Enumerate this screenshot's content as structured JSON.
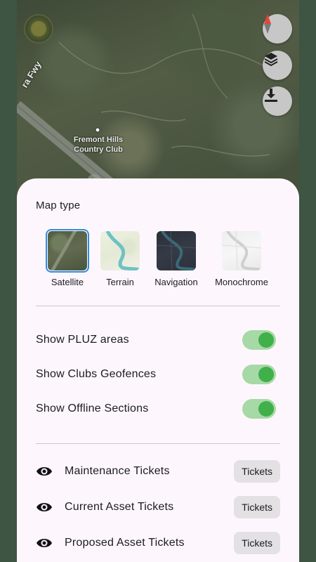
{
  "map": {
    "place_label": "Fremont Hills Country Club",
    "road_label": "ra Fwy",
    "buttons": {
      "compass_icon": "compass-icon",
      "layers_icon": "layers-icon",
      "download_icon": "download-icon"
    }
  },
  "sheet": {
    "map_type_title": "Map type",
    "map_types": [
      {
        "label": "Satellite",
        "selected": true
      },
      {
        "label": "Terrain",
        "selected": false
      },
      {
        "label": "Navigation",
        "selected": false
      },
      {
        "label": "Monochrome",
        "selected": false
      }
    ],
    "toggles": [
      {
        "label": "Show PLUZ areas",
        "on": true
      },
      {
        "label": "Show Clubs Geofences",
        "on": true
      },
      {
        "label": "Show Offline Sections",
        "on": true
      }
    ],
    "tickets": [
      {
        "label": "Maintenance Tickets",
        "button": "Tickets",
        "icon": "eye-icon"
      },
      {
        "label": "Current Asset Tickets",
        "button": "Tickets",
        "icon": "eye-icon"
      },
      {
        "label": "Proposed Asset Tickets",
        "button": "Tickets",
        "icon": "eye-icon"
      }
    ]
  },
  "colors": {
    "accent_selected": "#2f8de0",
    "switch_track": "#a6d9a6",
    "switch_knob": "#3fb04a",
    "sheet_background": "#fdf7fd"
  }
}
